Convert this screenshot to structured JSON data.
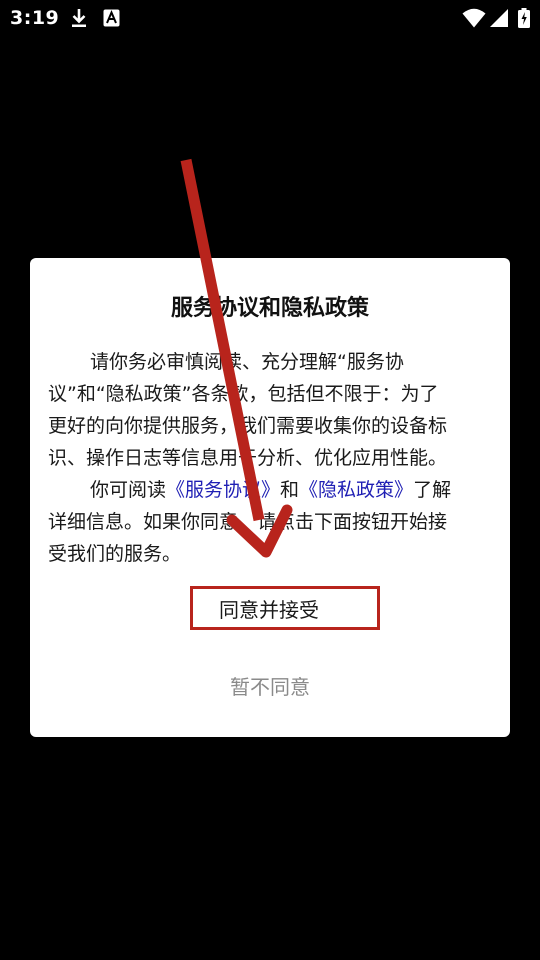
{
  "status_bar": {
    "time": "3:19",
    "icons": [
      "download-icon",
      "text-a-icon",
      "wifi-icon",
      "signal-icon",
      "battery-charging-icon"
    ]
  },
  "dialog": {
    "title": "服务协议和隐私政策",
    "para1_line1": "请你务必审慎阅读、充分理解“服务协",
    "para1_line2": "议”和“隐私政策”各条款，包括但不限于：为了",
    "para1_line3": "更好的向你提供服务，我们需要收集你的设备标",
    "para1_line4": "识、操作日志等信息用于分析、优化应用性能。",
    "para2_prefix": "你可阅读",
    "link_service": "《服务协议》",
    "para2_and": "和",
    "link_privacy": "《隐私政策》",
    "para2_suffix": "了解",
    "para2_line2": "详细信息。如果你同意，请点击下面按钮开始接",
    "para2_line3": "受我们的服务。",
    "accept_label": "同意并接受",
    "decline_label": "暂不同意"
  },
  "colors": {
    "annotation_red": "#b8241c",
    "link_blue": "#1f1fb4",
    "decline_gray": "#8a8a8a"
  }
}
